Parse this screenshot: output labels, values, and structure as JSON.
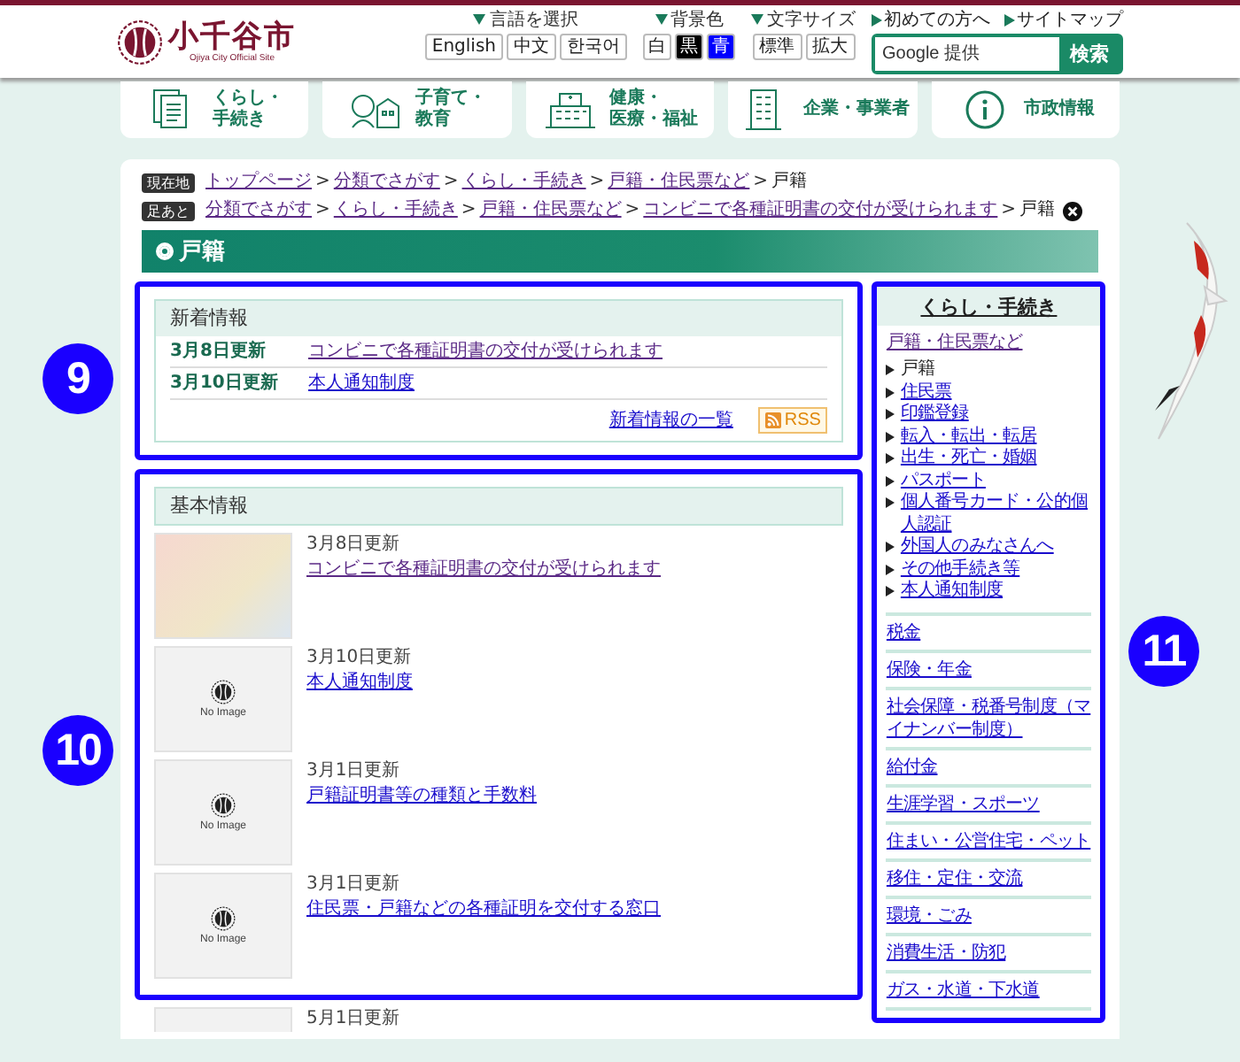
{
  "header": {
    "logo": {
      "name": "小千谷市",
      "subtitle": "Ojiya City Official Site"
    },
    "language": {
      "label": "言語を選択",
      "options": [
        "English",
        "中文",
        "한국어"
      ]
    },
    "background": {
      "label": "背景色",
      "options": [
        {
          "label": "白",
          "color": "#ffffff"
        },
        {
          "label": "黒",
          "color": "#000000"
        },
        {
          "label": "青",
          "color": "#0000ff"
        }
      ]
    },
    "font_size": {
      "label": "文字サイズ",
      "options": [
        "標準",
        "拡大"
      ]
    },
    "links": [
      "初めての方へ",
      "サイトマップ"
    ],
    "search": {
      "placeholder": "Google 提供",
      "button": "検索"
    }
  },
  "nav": [
    {
      "kind": "documents",
      "lines": [
        "くらし・",
        "手続き"
      ]
    },
    {
      "kind": "family",
      "lines": [
        "子育て・",
        "教育"
      ]
    },
    {
      "kind": "hospital",
      "lines": [
        "健康・",
        "医療・福祉"
      ]
    },
    {
      "kind": "office",
      "lines": [
        "企業・事業者"
      ]
    },
    {
      "kind": "info",
      "lines": [
        "市政情報"
      ]
    }
  ],
  "breadcrumbs": {
    "separator": ">",
    "trails": [
      {
        "badge": "現在地",
        "closable": false,
        "items": [
          {
            "label": "トップページ",
            "current": false
          },
          {
            "label": "分類でさがす",
            "current": false
          },
          {
            "label": "くらし・手続き",
            "current": false
          },
          {
            "label": "戸籍・住民票など",
            "current": false
          },
          {
            "label": "戸籍",
            "current": true
          }
        ]
      },
      {
        "badge": "足あと",
        "closable": true,
        "items": [
          {
            "label": "分類でさがす",
            "current": false
          },
          {
            "label": "くらし・手続き",
            "current": false
          },
          {
            "label": "戸籍・住民票など",
            "current": false
          },
          {
            "label": "コンビニで各種証明書の交付が受けられます",
            "current": false
          },
          {
            "label": "戸籍",
            "current": true
          }
        ]
      }
    ]
  },
  "page_title": "戸籍",
  "new_info": {
    "callout": "9",
    "title": "新着情報",
    "rows": [
      {
        "date": "3月8日更新",
        "link": "コンビニで各種証明書の交付が受けられます",
        "visited": true
      },
      {
        "date": "3月10日更新",
        "link": "本人通知制度",
        "visited": false
      }
    ],
    "more_link": "新着情報の一覧",
    "rss": "RSS"
  },
  "basic_info": {
    "callout": "10",
    "title": "基本情報",
    "items": [
      {
        "kind": "photo",
        "date": "3月8日更新",
        "link": "コンビニで各種証明書の交付が受けられます",
        "visited": true
      },
      {
        "kind": "placeholder",
        "no_image_text": "No Image",
        "date": "3月10日更新",
        "link": "本人通知制度",
        "visited": false
      },
      {
        "kind": "placeholder",
        "no_image_text": "No Image",
        "date": "3月1日更新",
        "link": "戸籍証明書等の種類と手数料",
        "visited": false
      },
      {
        "kind": "placeholder",
        "no_image_text": "No Image",
        "date": "3月1日更新",
        "link": "住民票・戸籍などの各種証明を交付する窓口",
        "visited": false
      },
      {
        "kind": "placeholder",
        "date": "5月1日更新"
      }
    ]
  },
  "sidebar": {
    "callout": "11",
    "title": "くらし・手続き",
    "groups": [
      {
        "label": "戸籍・住民票など",
        "visited": true,
        "children": [
          {
            "label": "戸籍",
            "selected": true
          },
          {
            "label": "住民票",
            "selected": false
          },
          {
            "label": "印鑑登録",
            "selected": false
          },
          {
            "label": "転入・転出・転居",
            "selected": false
          },
          {
            "label": "出生・死亡・婚姻",
            "selected": false
          },
          {
            "label": "パスポート",
            "selected": false
          },
          {
            "label": "個人番号カード・公的個人認証",
            "selected": false
          },
          {
            "label": "外国人のみなさんへ",
            "selected": false
          },
          {
            "label": "その他手続き等",
            "selected": false
          },
          {
            "label": "本人通知制度",
            "selected": false
          }
        ]
      },
      {
        "label": "税金",
        "visited": false
      },
      {
        "label": "保険・年金",
        "visited": false
      },
      {
        "label": "社会保障・税番号制度（マイナンバー制度）",
        "visited": false
      },
      {
        "label": "給付金",
        "visited": false
      },
      {
        "label": "生涯学習・スポーツ",
        "visited": false
      },
      {
        "label": "住まい・公営住宅・ペット",
        "visited": false
      },
      {
        "label": "移住・定住・交流",
        "visited": false
      },
      {
        "label": "環境・ごみ",
        "visited": false
      },
      {
        "label": "消費生活・防犯",
        "visited": false
      },
      {
        "label": "ガス・水道・下水道",
        "visited": false
      }
    ]
  }
}
